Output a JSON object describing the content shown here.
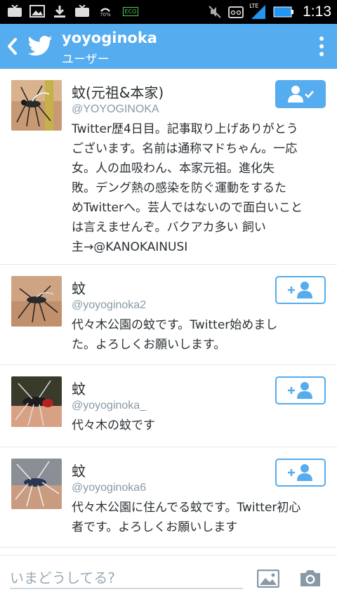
{
  "statusbar": {
    "time": "1:13",
    "battery_percent": "70%",
    "network": "LTE",
    "eco_label": "ECO",
    "icons": [
      "tv-icon",
      "image-icon",
      "download-icon",
      "tv-icon",
      "battery-saver-icon",
      "eco-icon",
      "mute-icon",
      "voicemail-icon",
      "signal-icon",
      "battery-icon"
    ]
  },
  "header": {
    "title": "yoyoginoka",
    "subtitle": "ユーザー",
    "back_icon": "back-chevron-icon",
    "logo_icon": "twitter-bird-icon",
    "menu_icon": "overflow-menu-icon"
  },
  "users": [
    {
      "name": "蚊(元祖&本家)",
      "handle": "@YOYOGINOKA",
      "bio_lines": [
        "Twitter歴4日目。記事取り上げありがとう",
        "ございます。名前は通称マドちゃん。一応",
        "女。人の血吸わん、本家元祖。進化失",
        "敗。デング熱の感染を防ぐ運動をするた",
        "めTwitterへ。芸人ではないので面白いこと",
        "は言えませんぞ。バクアカ多い 飼い",
        "主→@KANOKAINUSI"
      ],
      "following": true
    },
    {
      "name": "蚊",
      "handle": "@yoyoginoka2",
      "bio_lines": [
        "代々木公園の蚊です。Twitter始めまし",
        "た。よろしくお願いします。"
      ],
      "following": false
    },
    {
      "name": "蚊",
      "handle": "@yoyoginoka_",
      "bio_lines": [
        "代々木の蚊です"
      ],
      "following": false
    },
    {
      "name": "蚊",
      "handle": "@yoyoginoka6",
      "bio_lines": [
        "代々木公園に住んでる蚊です。Twitter初心",
        "者です。よろしくお願いします"
      ],
      "following": false
    }
  ],
  "compose": {
    "placeholder": "いまどうしてる?",
    "photo_icon": "photo-icon",
    "camera_icon": "camera-icon"
  },
  "colors": {
    "brand": "#55acee",
    "text": "#292f33",
    "muted": "#8899a6",
    "divider": "#e1e8ed"
  }
}
